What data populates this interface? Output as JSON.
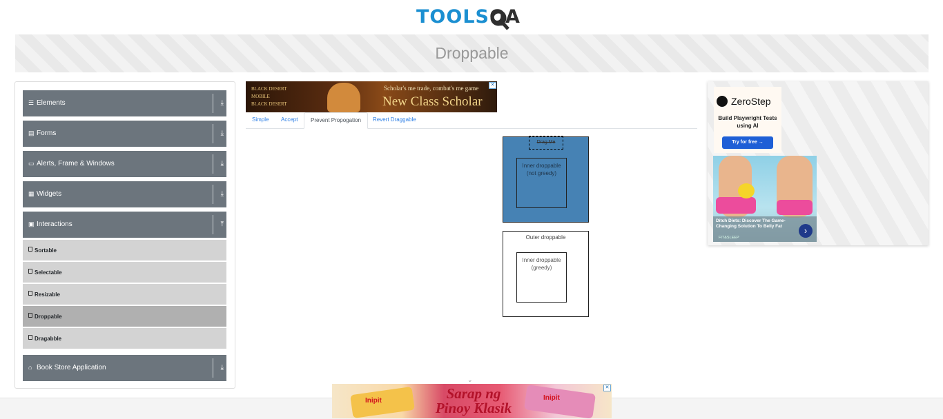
{
  "header": {
    "logo_text": "TOOLS",
    "logo_text_2": "QA",
    "page_title": "Droppable"
  },
  "sidebar": {
    "groups": [
      {
        "label": "Elements",
        "icon": "list-icon",
        "arrow": "download-arrow-icon"
      },
      {
        "label": "Forms",
        "icon": "document-icon",
        "arrow": "download-arrow-icon"
      },
      {
        "label": "Alerts, Frame & Windows",
        "icon": "window-icon",
        "arrow": "download-arrow-icon"
      },
      {
        "label": "Widgets",
        "icon": "grid-icon",
        "arrow": "download-arrow-icon"
      },
      {
        "label": "Interactions",
        "icon": "cursor-box-icon",
        "arrow": "upload-arrow-icon"
      },
      {
        "label": "Book Store Application",
        "icon": "bank-icon",
        "arrow": "download-arrow-icon"
      }
    ],
    "items": [
      {
        "label": "Sortable"
      },
      {
        "label": "Selectable"
      },
      {
        "label": "Resizable"
      },
      {
        "label": "Droppable",
        "active": true
      },
      {
        "label": "Dragabble"
      }
    ]
  },
  "ads": {
    "top": {
      "brand_line_1": "BLACK DESERT",
      "brand_line_2": "MOBILE",
      "brand_line_3": "BLACK DESERT",
      "tagline": "Scholar's me trade, combat's me game",
      "headline": "New Class Scholar"
    },
    "right": {
      "zerostep_name": "ZeroStep",
      "zerostep_tagline": "Build Playwright Tests using AI",
      "zerostep_button": "Try for free →",
      "fitness_caption": "Ditch Diets: Discover The Game-Changing Solution To Belly Fat",
      "fitness_source": "FIT&SLEEP"
    },
    "bottom": {
      "slogan": "Sarap ng Pinoy Klasik",
      "brand": "Inipit"
    }
  },
  "tabs": [
    {
      "label": "Simple"
    },
    {
      "label": "Accept"
    },
    {
      "label": "Prevent Propogation",
      "active": true
    },
    {
      "label": "Revert Draggable"
    }
  ],
  "demo": {
    "drag_box": "Drag Me",
    "outer_not_greedy": "",
    "inner_not_greedy": "Inner droppable (not greedy)",
    "outer_greedy": "Outer droppable",
    "inner_greedy": "Inner droppable (greedy)"
  },
  "colors": {
    "primary": "#1b8fd1",
    "sidebar_group_bg": "#6c757d",
    "sidebar_item_bg": "#d3d3d3",
    "sidebar_item_active_bg": "#b0b0b0",
    "droppable_highlight": "#4682b4",
    "tab_link": "#2b7ee6"
  }
}
